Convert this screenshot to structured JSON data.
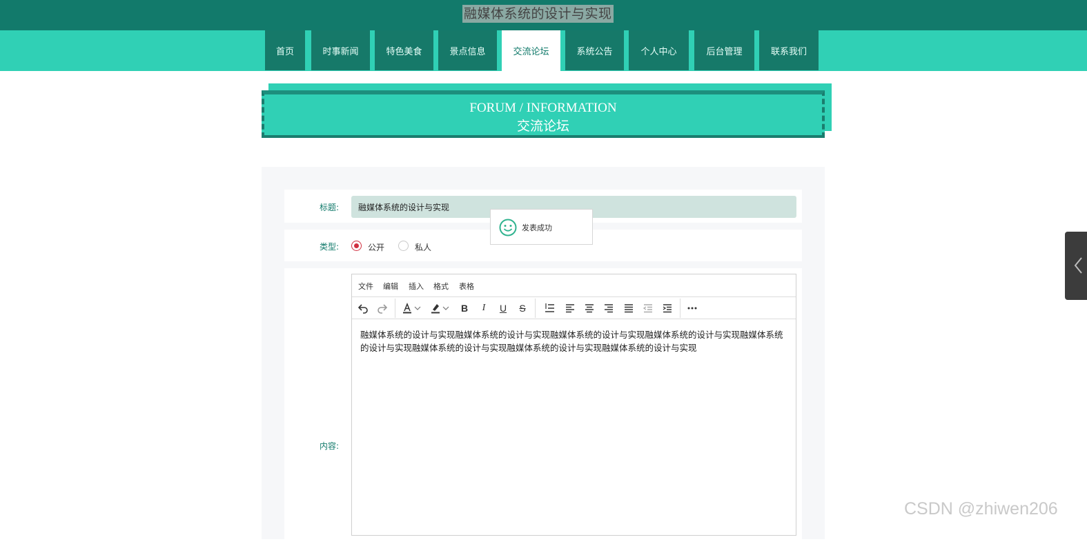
{
  "site": {
    "title": "融媒体系统的设计与实现"
  },
  "nav": {
    "items": [
      {
        "label": "首页"
      },
      {
        "label": "时事新闻"
      },
      {
        "label": "特色美食"
      },
      {
        "label": "景点信息"
      },
      {
        "label": "交流论坛"
      },
      {
        "label": "系统公告"
      },
      {
        "label": "个人中心"
      },
      {
        "label": "后台管理"
      },
      {
        "label": "联系我们"
      }
    ],
    "active_index": 4
  },
  "section": {
    "en": "FORUM / INFORMATION",
    "cn": "交流论坛"
  },
  "form": {
    "title_label": "标题:",
    "title_value": "融媒体系统的设计与实现",
    "type_label": "类型:",
    "type_options": [
      "公开",
      "私人"
    ],
    "type_selected": "公开",
    "content_label": "内容:"
  },
  "editor": {
    "menus": [
      "文件",
      "编辑",
      "插入",
      "格式",
      "表格"
    ],
    "toolbar_icons": [
      "undo-icon",
      "redo-icon",
      "font-color-icon",
      "highlight-icon",
      "bold-icon",
      "italic-icon",
      "underline-icon",
      "strikethrough-icon",
      "line-height-icon",
      "align-left-icon",
      "align-center-icon",
      "align-right-icon",
      "align-justify-icon",
      "outdent-icon",
      "indent-icon",
      "more-icon"
    ],
    "content": "融媒体系统的设计与实现融媒体系统的设计与实现融媒体系统的设计与实现融媒体系统的设计与实现融媒体系统的设计与实现融媒体系统的设计与实现融媒体系统的设计与实现融媒体系统的设计与实现"
  },
  "toast": {
    "message": "发表成功"
  },
  "watermark": "CSDN @zhiwen206",
  "colors": {
    "dark_green": "#127a6b",
    "teal": "#30d0b5",
    "nav_item": "#167969"
  }
}
